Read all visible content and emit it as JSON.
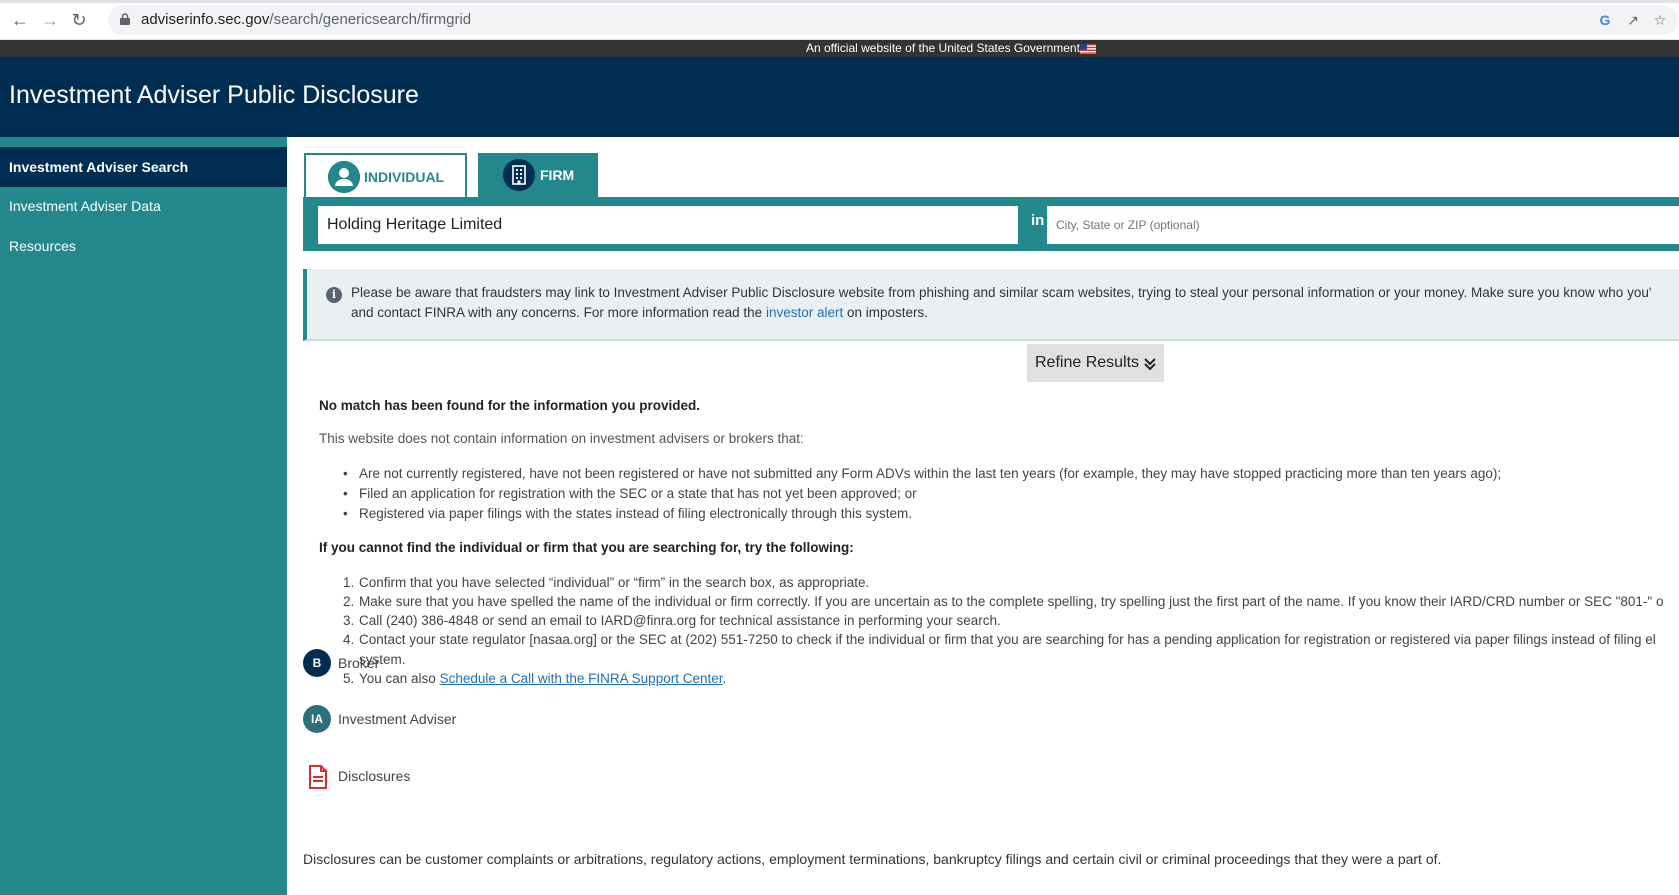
{
  "browser": {
    "url_domain": "adviserinfo.sec.gov",
    "url_path": "/search/genericsearch/firmgrid"
  },
  "gov_banner": {
    "text": "An official website of the United States Government"
  },
  "header": {
    "title": "Investment Adviser Public Disclosure"
  },
  "sidebar": {
    "items": [
      {
        "label": "Investment Adviser Search",
        "active": true
      },
      {
        "label": "Investment Adviser Data",
        "active": false
      },
      {
        "label": "Resources",
        "active": false
      }
    ]
  },
  "search": {
    "tabs": [
      {
        "label": "INDIVIDUAL",
        "selected": false
      },
      {
        "label": "FIRM",
        "selected": true
      }
    ],
    "query_value": "Holding Heritage Limited",
    "in_label": "in",
    "location_placeholder": "City, State or ZIP (optional)"
  },
  "alert": {
    "line1": "Please be aware that fraudsters may link to Investment Adviser Public Disclosure website from phishing and similar scam websites, trying to steal your personal information or your money. Make sure you know who you'",
    "line2_before": "and contact FINRA with any concerns. For more information read the ",
    "line2_link": "investor alert",
    "line2_after": " on imposters."
  },
  "refine": {
    "label": "Refine Results"
  },
  "results": {
    "no_match": "No match has been found for the information you provided.",
    "intro": "This website does not contain information on investment advisers or brokers that:",
    "bullets": [
      "Are not currently registered, have not been registered or have not submitted any Form ADVs within the last ten years (for example, they may have stopped practicing more than ten years ago);",
      "Filed an application for registration with the SEC or a state that has not yet been approved; or",
      "Registered via paper filings with the states instead of filing electronically through this system."
    ],
    "try_heading": "If you cannot find the individual or firm that you are searching for, try the following:",
    "steps": [
      "Confirm that you have selected “individual” or “firm” in the search box, as appropriate.",
      "Make sure that you have spelled the name of the individual or firm correctly. If you are uncertain as to the complete spelling, try spelling just the first part of the name. If you know their IARD/CRD number or SEC \"801-\" o",
      "Call (240) 386-4848 or send an email to IARD@finra.org for technical assistance in performing your search.",
      "Contact your state regulator [nasaa.org] or the SEC at (202) 551-7250 to check if the individual or firm that you are searching for has a pending application for registration or registered via paper filings instead of filing el"
    ],
    "step4_cont": "system.",
    "step5_before": "You can also ",
    "step5_link": "Schedule a Call with the FINRA Support Center",
    "step5_after": "."
  },
  "legend": {
    "broker_badge": "B",
    "broker_label": "Broker",
    "ia_badge": "IA",
    "ia_label": "Investment Adviser",
    "disclosures_label": "Disclosures",
    "disclosures_desc": "Disclosures can be customer complaints or arbitrations, regulatory actions, employment terminations, bankruptcy filings and certain civil or criminal proceedings that they were a part of."
  },
  "colors": {
    "navy": "#002d52",
    "teal": "#23888c",
    "link": "#1f6fb5",
    "disclosure_red": "#d0312d"
  }
}
